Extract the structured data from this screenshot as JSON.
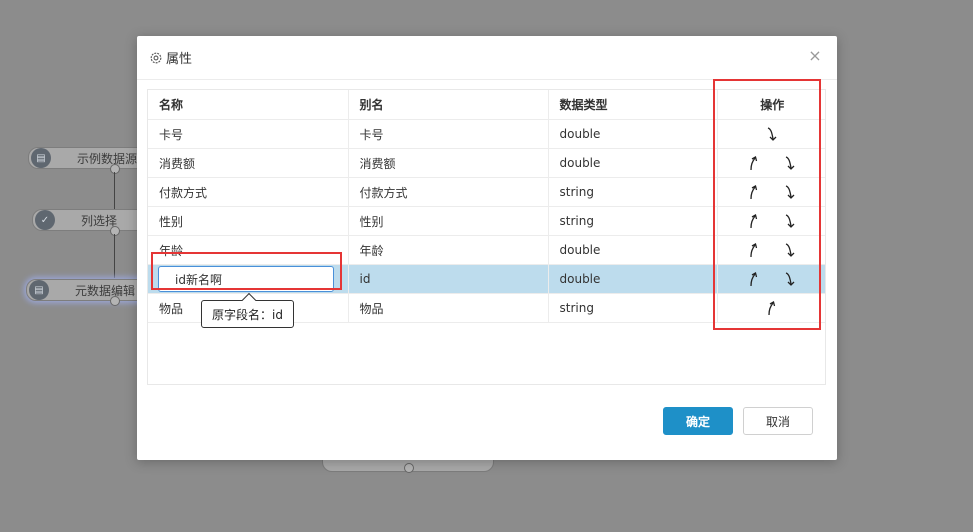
{
  "canvas": {
    "nodes": [
      {
        "label": "示例数据源",
        "icon": "database-icon"
      },
      {
        "label": "列选择",
        "icon": "column-select-icon"
      },
      {
        "label": "元数据编辑",
        "icon": "database-icon"
      }
    ]
  },
  "dialog": {
    "title": "属性",
    "close_label": "×",
    "columns": {
      "name": "名称",
      "alias": "别名",
      "type": "数据类型",
      "ops": "操作"
    },
    "rows": [
      {
        "name": "卡号",
        "alias": "卡号",
        "type": "double",
        "up": false,
        "down": true
      },
      {
        "name": "消费额",
        "alias": "消费额",
        "type": "double",
        "up": true,
        "down": true
      },
      {
        "name": "付款方式",
        "alias": "付款方式",
        "type": "string",
        "up": true,
        "down": true
      },
      {
        "name": "性别",
        "alias": "性别",
        "type": "string",
        "up": true,
        "down": true
      },
      {
        "name": "年龄",
        "alias": "年龄",
        "type": "double",
        "up": true,
        "down": true
      },
      {
        "name": "id新名啊",
        "alias": "id",
        "type": "double",
        "up": true,
        "down": true,
        "editing": true,
        "selected": true
      },
      {
        "name": "物品",
        "alias": "物品",
        "type": "string",
        "up": true,
        "down": false
      }
    ],
    "tooltip": "原字段名：id",
    "ok_label": "确定",
    "cancel_label": "取消"
  },
  "colors": {
    "primary": "#1e90c8",
    "selected_row": "#bddced",
    "highlight": "#e53535"
  }
}
